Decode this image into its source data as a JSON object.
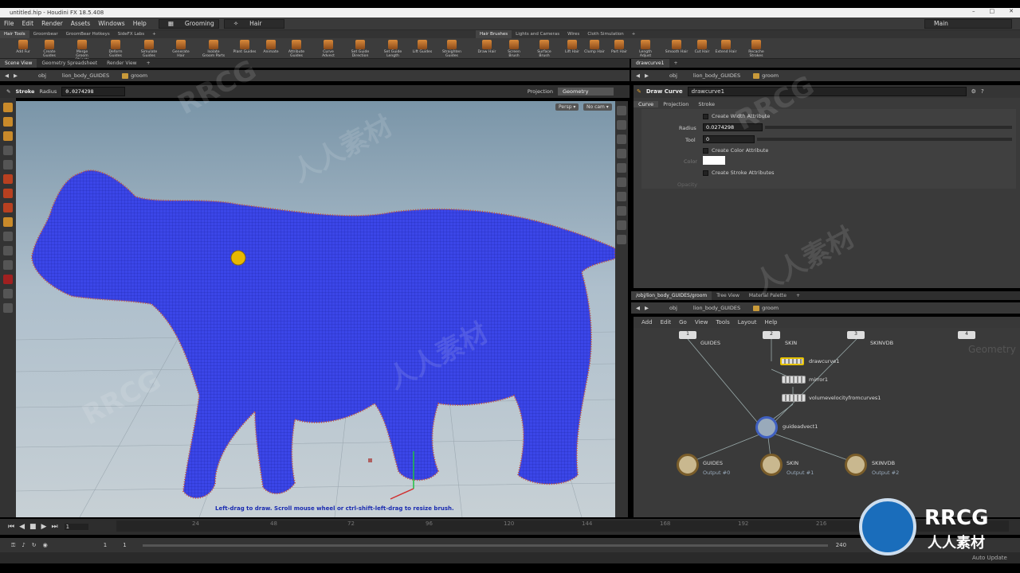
{
  "window": {
    "title": "untitled.hip - Houdini FX 18.5.408"
  },
  "menu": [
    "File",
    "Edit",
    "Render",
    "Assets",
    "Windows",
    "Help"
  ],
  "desktop_dropdown": "Grooming",
  "hair_dropdown": "Hair",
  "main_dropdown": "Main",
  "shelf_tabs_left": [
    "Hair Tools",
    "Groombear",
    "GroomBear Hotkeys",
    "SideFX Labs"
  ],
  "shelf_tabs_right": [
    "Hair Brushes",
    "Lights and Cameras",
    "Wires",
    "Cloth Simulation"
  ],
  "shelf_tools_left": [
    "Add Fur",
    "Create Guides",
    "Merge Groom Objects",
    "Deform Guides",
    "Simulate Guides",
    "Generate Hair",
    "Isolate Groom Parts",
    "Plant Guides",
    "Animate",
    "Attribute Guides",
    "Curve Advect",
    "Set Guide Direction",
    "Set Guide Length",
    "Lift Guides",
    "Straighten Guides"
  ],
  "shelf_tools_right": [
    "Draw Hair",
    "Screen Brush",
    "Surface Brush",
    "Lift Hair",
    "Clump Hair",
    "Part Hair",
    "Length Adjust",
    "Smooth Hair",
    "Cut Hair",
    "Extend Hair",
    "Recache Strokes"
  ],
  "left_pane_tabs": [
    "Scene View",
    "Geometry Spreadsheet",
    "Render View"
  ],
  "left_path": {
    "obj": "obj",
    "node": "lion_body_GUIDES",
    "groom": "groom"
  },
  "stroke_bar": {
    "label": "Stroke",
    "radius_label": "Radius",
    "radius": "0.0274298",
    "projection_label": "Projection",
    "projection": "Geometry"
  },
  "viewport": {
    "persp": "Persp",
    "cam": "No cam",
    "hint": "Left-drag to draw.  Scroll mouse wheel or ctrl-shift-left-drag to resize brush."
  },
  "right_top_tab": "drawcurve1",
  "right_path": {
    "obj": "obj",
    "node": "lion_body_GUIDES",
    "groom": "groom"
  },
  "param": {
    "type": "Draw Curve",
    "name": "drawcurve1",
    "tabs": [
      "Curve",
      "Projection",
      "Stroke"
    ],
    "create_width": "Create Width Attribute",
    "radius_label": "Radius",
    "radius": "0.0274298",
    "tool_label": "Tool",
    "tool": "0",
    "create_color": "Create Color Attribute",
    "color_label": "Color",
    "create_stroke": "Create Stroke Attributes",
    "opacity_label": "Opacity"
  },
  "net_tabs": [
    "/obj/lion_body_GUIDES/groom",
    "Tree View",
    "Material Palette"
  ],
  "net_path": {
    "obj": "obj",
    "node": "lion_body_GUIDES",
    "groom": "groom"
  },
  "net_menu": [
    "Add",
    "Edit",
    "Go",
    "View",
    "Tools",
    "Layout",
    "Help"
  ],
  "net_context": "Geometry",
  "inputs": [
    {
      "num": "1",
      "label": "GUIDES"
    },
    {
      "num": "2",
      "label": "SKIN"
    },
    {
      "num": "3",
      "label": "SKINVDB"
    },
    {
      "num": "4",
      "label": ""
    }
  ],
  "nodes": [
    "drawcurve1",
    "mirror1",
    "volumevelocityfromcurves1",
    "guideadvect1"
  ],
  "outputs": [
    {
      "label": "GUIDES",
      "sub": "Output #0"
    },
    {
      "label": "SKIN",
      "sub": "Output #1"
    },
    {
      "label": "SKINVDB",
      "sub": "Output #2"
    }
  ],
  "timeline": {
    "frame": "1",
    "ticks": [
      "24",
      "48",
      "72",
      "96",
      "120",
      "144",
      "168",
      "192",
      "216"
    ],
    "end": "240"
  },
  "playbar": {
    "start": "1",
    "start2": "1"
  },
  "status": {
    "auto_update": "Auto Update"
  },
  "watermarks": [
    "RRCG",
    "人人素材"
  ],
  "logo": {
    "text": "RRCG",
    "sub": "人人素材"
  }
}
